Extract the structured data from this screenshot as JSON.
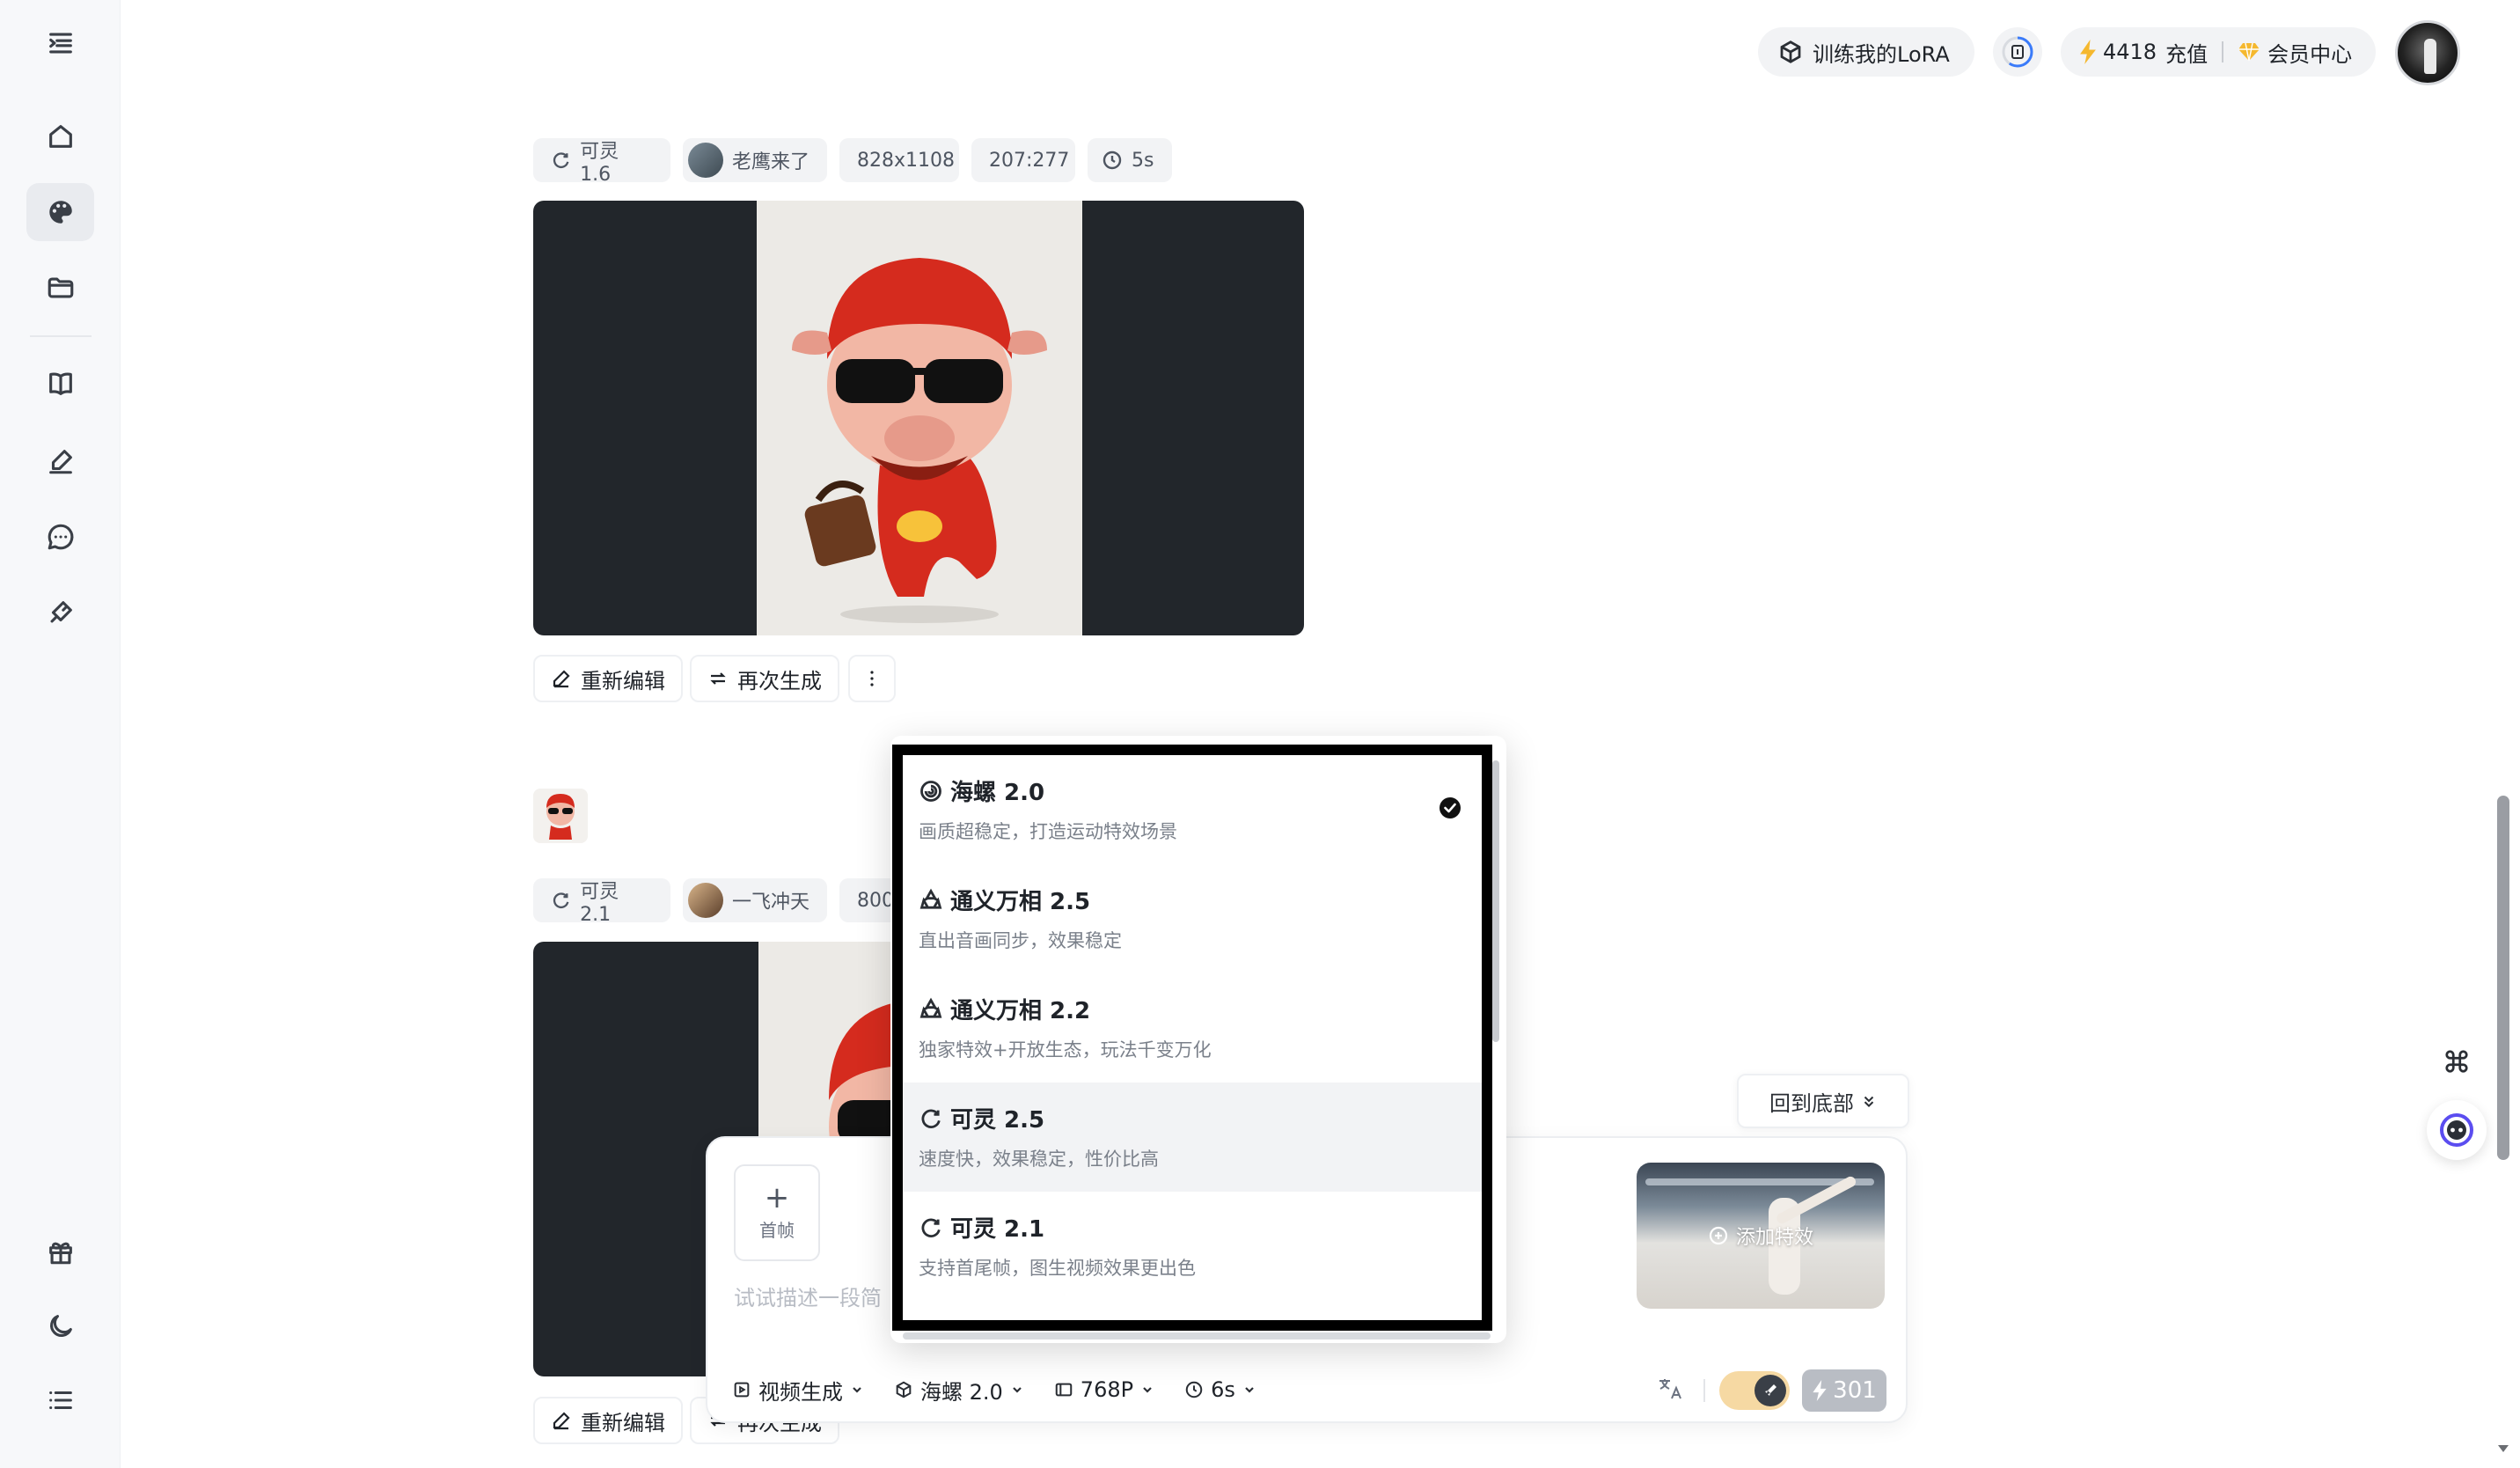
{
  "header": {
    "lora_label": "训练我的LoRA",
    "credits": "4418",
    "recharge_label": "充值",
    "member_label": "会员中心"
  },
  "feed": {
    "post1": {
      "model": "可灵 1.6",
      "user": "老鹰来了",
      "size": "828x1108",
      "ratio": "207:277",
      "duration": "5s",
      "re_edit": "重新编辑",
      "regenerate": "再次生成"
    },
    "post2": {
      "model": "可灵 2.1",
      "user": "一飞冲天",
      "size_partial": "800",
      "re_edit": "重新编辑",
      "regenerate": "再次生成"
    }
  },
  "back_to_bottom": "回到底部",
  "composer": {
    "first_frame": "首帧",
    "prompt_placeholder": "试试描述一段简",
    "effect_label": "添加特效",
    "mode": "视频生成",
    "model": "海螺 2.0",
    "resolution": "768P",
    "duration": "6s",
    "cost": "301"
  },
  "model_dropdown": {
    "items": [
      {
        "name": "海螺 2.0",
        "desc": "画质超稳定，打造运动特效场景",
        "selected": true,
        "icon": "hailuo-icon"
      },
      {
        "name": "通义万相 2.5",
        "desc": "直出音画同步，效果稳定",
        "selected": false,
        "icon": "tongyi-icon"
      },
      {
        "name": "通义万相 2.2",
        "desc": "独家特效+开放生态，玩法千变万化",
        "selected": false,
        "icon": "tongyi-icon"
      },
      {
        "name": "可灵 2.5",
        "desc": "速度快，效果稳定，性价比高",
        "selected": false,
        "icon": "kling-icon"
      },
      {
        "name": "可灵 2.1",
        "desc": "支持首尾帧，图生视频效果更出色",
        "selected": false,
        "icon": "kling-icon"
      }
    ]
  },
  "colors": {
    "sidebar_bg": "#f7f8fa",
    "accent_gold": "#f5b82e",
    "toggle_bg": "#f6d9a3",
    "bot_purple": "#5b4df0"
  }
}
